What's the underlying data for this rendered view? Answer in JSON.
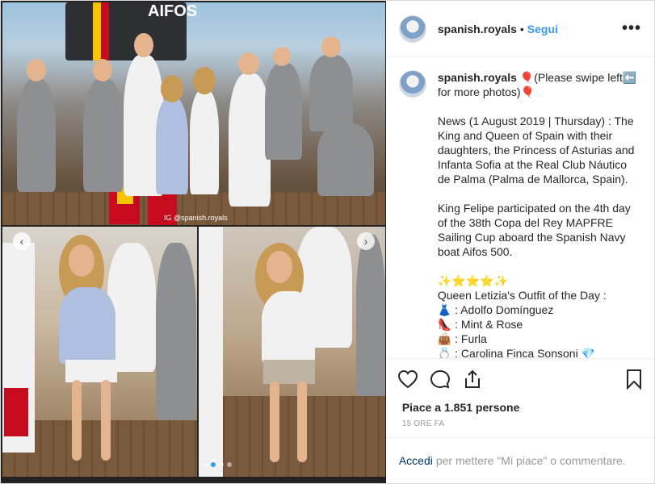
{
  "header": {
    "username": "spanish.royals",
    "separator": "•",
    "follow_label": "Segui",
    "more_label": "•••"
  },
  "caption": {
    "username": "spanish.royals",
    "first_line": "🎈(Please swipe left⬅️ for more photos)🎈",
    "news": "News (1 August 2019 | Thursday) : The King and Queen of Spain with their daughters, the Princess of Asturias and Infanta Sofia at the Real Club Náutico de Palma (Palma de Mallorca, Spain).",
    "participation": "King Felipe participated on the 4th day of the 38th Copa del Rey MAPFRE Sailing Cup aboard the Spanish Navy boat Aifos 500.",
    "sparkles": "✨⭐⭐⭐✨",
    "outfit_title": "Queen Letizia's Outfit of the Day :",
    "outfit_items": [
      "👗 : Adolfo Domínguez",
      "👠 : Mint & Rose",
      "👜 : Furla",
      "💍 : Carolina Finca Sonsoni 💎"
    ]
  },
  "photo": {
    "sail_text": "AIFOS",
    "watermark": "IG @spanish.royals",
    "dots_count": 4,
    "active_dot": 1
  },
  "actions": {
    "like_icon": "heart-icon",
    "comment_icon": "comment-icon",
    "share_icon": "share-icon",
    "save_icon": "bookmark-icon"
  },
  "likes_text": "Piace a 1.851 persone",
  "timestamp": "15 ORE FA",
  "login": {
    "link_label": "Accedi",
    "rest": "per mettere \"Mi piace\" o commentare."
  },
  "colors": {
    "link_blue": "#3897f0",
    "login_link": "#003569",
    "secondary_text": "#999999"
  }
}
